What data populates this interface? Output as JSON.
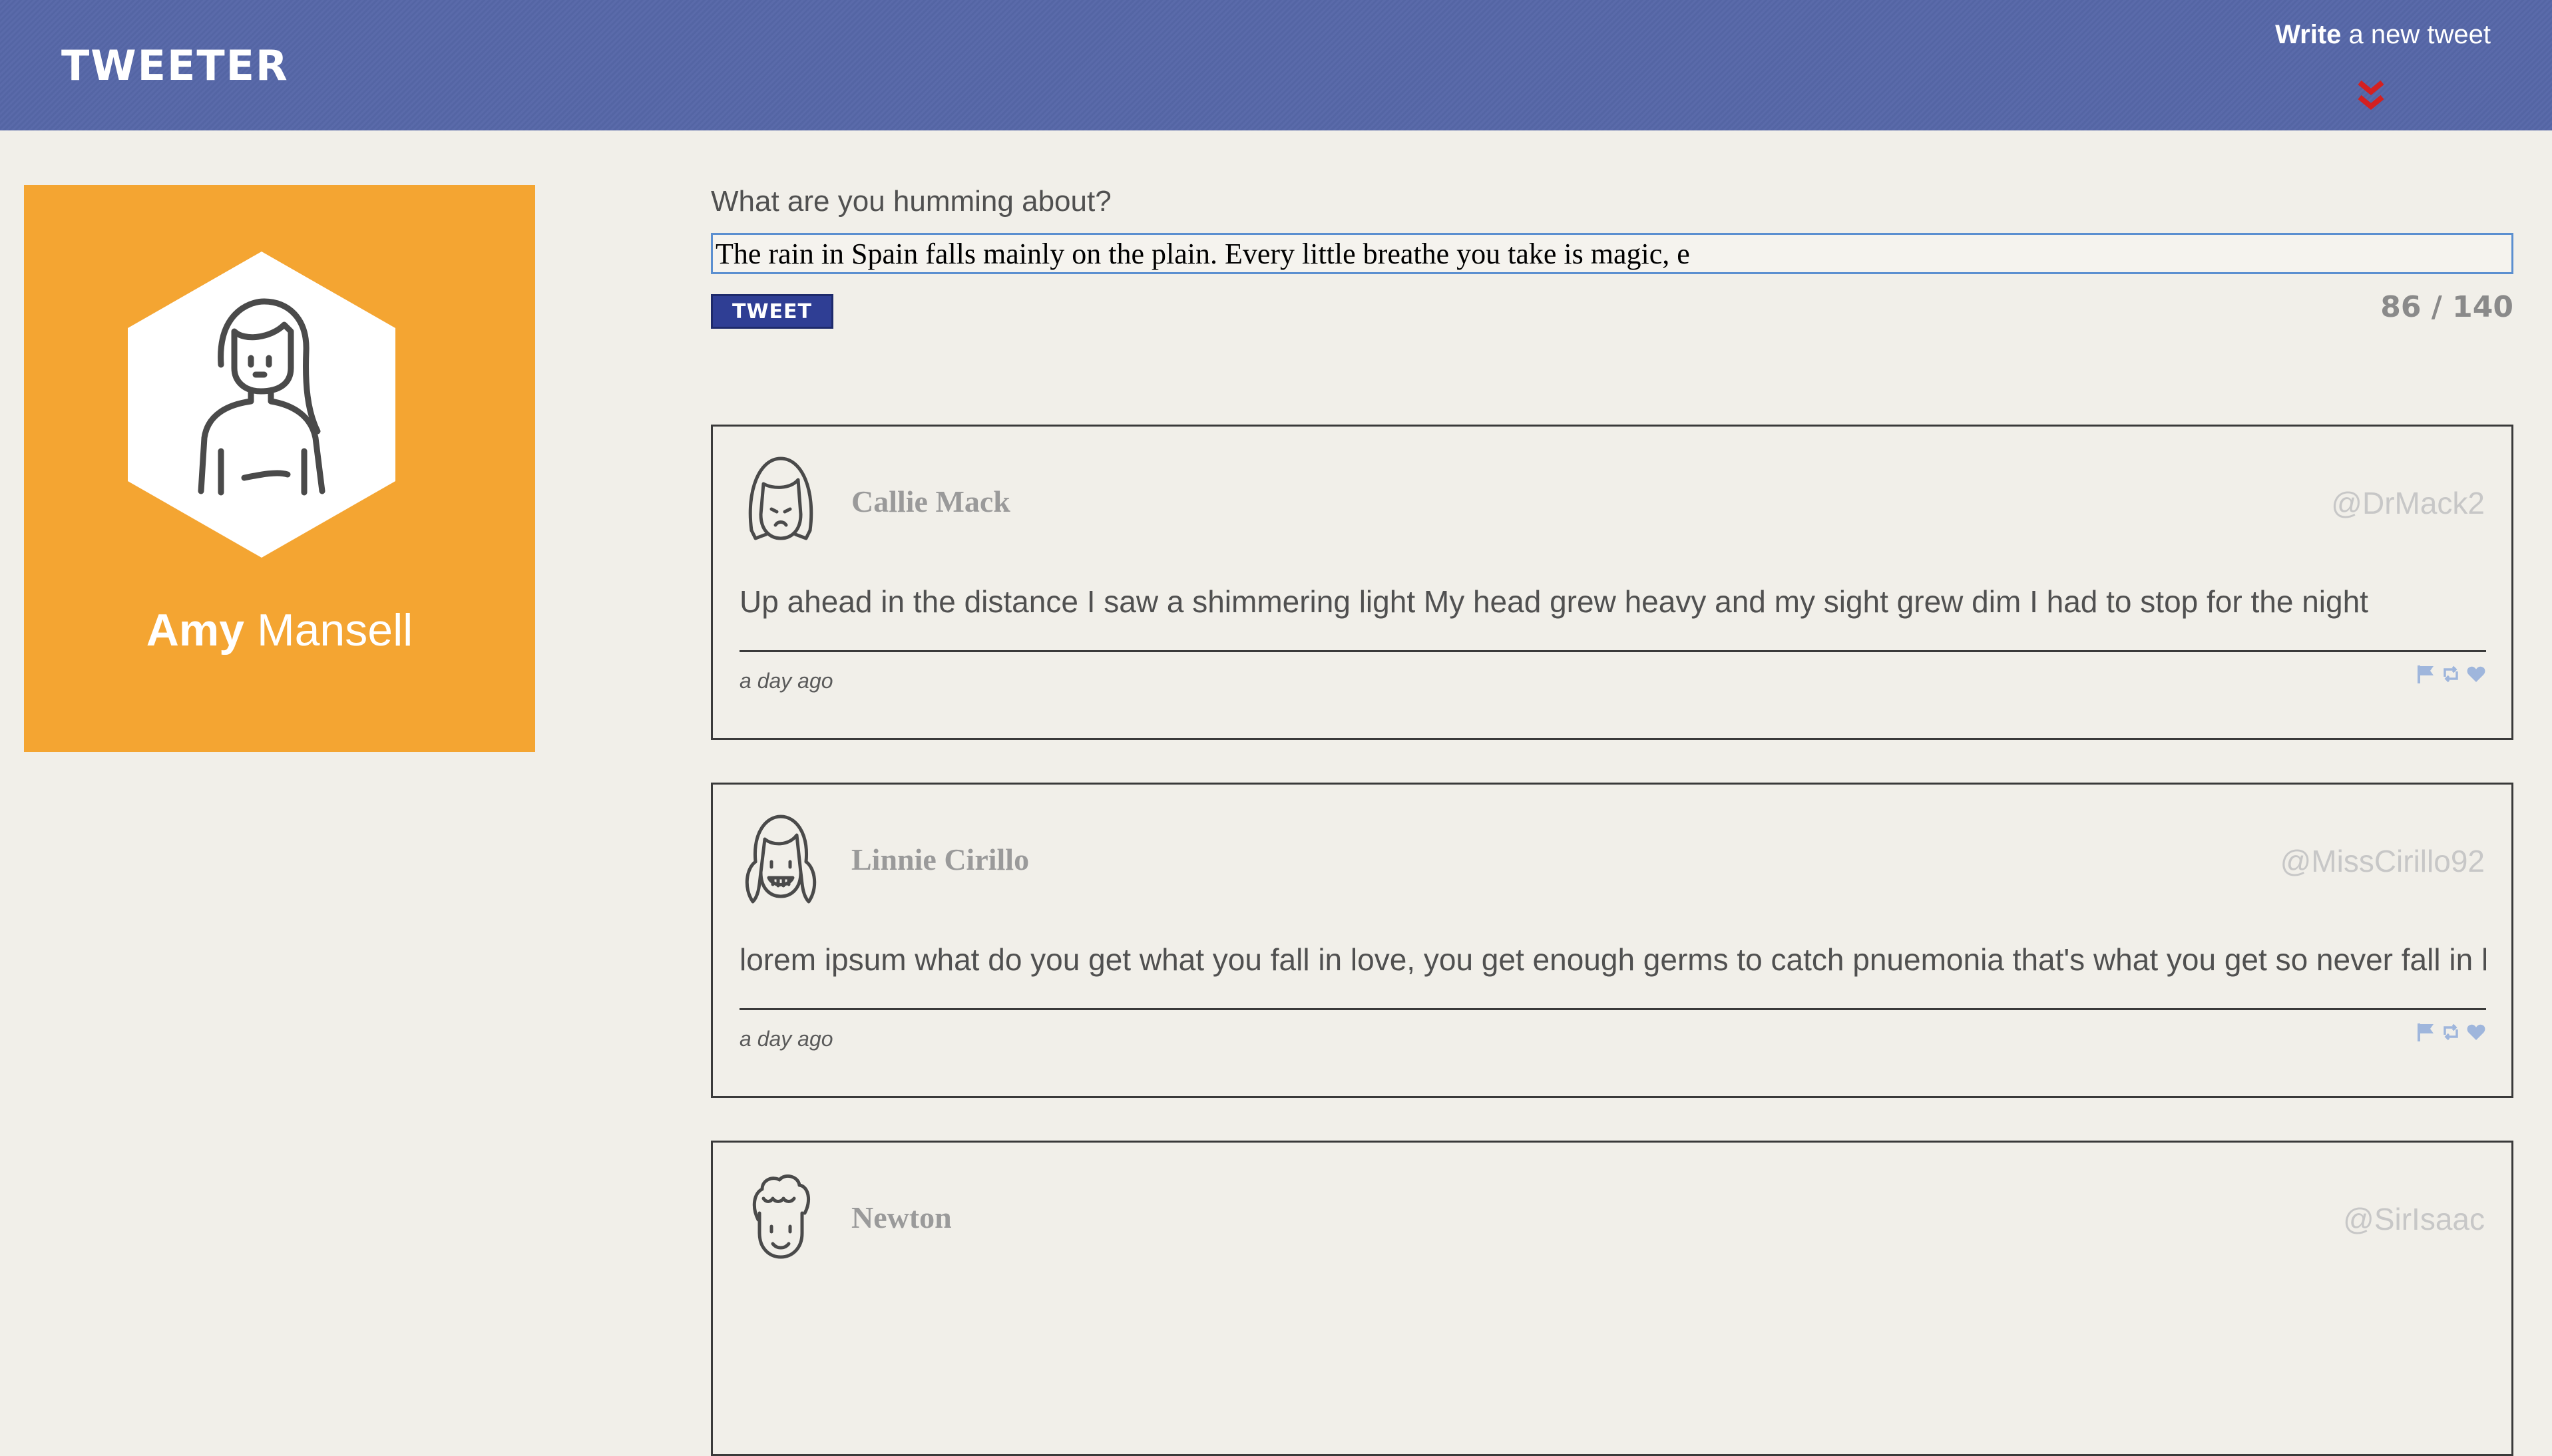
{
  "header": {
    "brand": "TWEETER",
    "compose_bold": "Write",
    "compose_rest": " a new tweet",
    "chevron_color": "#d42020",
    "bg_color": "#5667a8"
  },
  "profile": {
    "first_name": "Amy",
    "last_name": " Mansell",
    "bg_color": "#f4a532",
    "avatar_icon": "woman-avatar-icon"
  },
  "compose": {
    "label": "What are you humming about?",
    "value": "The rain in Spain falls mainly on the plain. Every little breathe you take is magic, e",
    "button_label": "TWEET",
    "counter": "86 / 140",
    "button_color": "#2f3e94"
  },
  "tweets": [
    {
      "name": "Callie Mack",
      "handle": "@DrMack2",
      "text": "Up ahead in the distance I saw a shimmering light My head grew heavy and my sight grew dim I had to stop for the night",
      "time": "a day ago",
      "avatar_icon": "sad-girl-avatar-icon"
    },
    {
      "name": "Linnie Cirillo",
      "handle": "@MissCirillo92",
      "text": "lorem ipsum what do you get what you fall in love, you get enough germs to catch pnuemonia that's what you get so never fall in love, I'll",
      "time": "a day ago",
      "avatar_icon": "grinning-girl-avatar-icon"
    },
    {
      "name": "Newton",
      "handle": "@SirIsaac",
      "text": "",
      "time": "",
      "avatar_icon": "curly-hair-man-avatar-icon"
    }
  ],
  "action_icons": [
    "flag-icon",
    "retweet-icon",
    "heart-icon"
  ],
  "action_color": "#9fb6dc"
}
